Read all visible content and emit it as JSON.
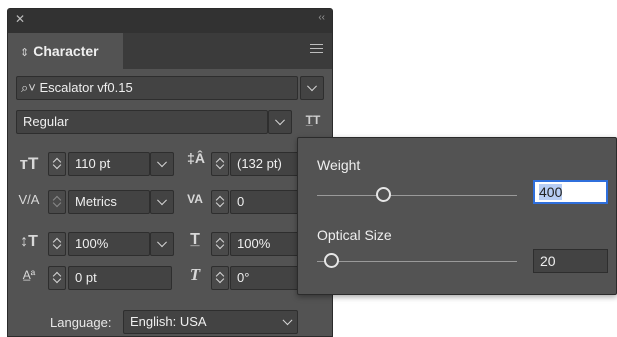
{
  "panel": {
    "tab_label": "Character",
    "font": {
      "search_icon": "search-icon",
      "value": "Escalator vf0.15"
    },
    "style": {
      "value": "Regular"
    },
    "size": {
      "value": "110 pt"
    },
    "leading": {
      "value": "(132 pt)"
    },
    "kerning": {
      "value": "Metrics"
    },
    "tracking": {
      "value": "0"
    },
    "vertical_scale": {
      "value": "100%"
    },
    "horizontal_scale": {
      "value": "100%"
    },
    "baseline_shift": {
      "value": "0 pt"
    },
    "skew": {
      "value": "0°"
    },
    "language": {
      "label": "Language:",
      "value": "English: USA"
    }
  },
  "popover": {
    "weight": {
      "label": "Weight",
      "value": "400",
      "level": 0.33
    },
    "optical_size": {
      "label": "Optical Size",
      "value": "20",
      "level": 0.07
    }
  },
  "colors": {
    "panel_bg": "#535353",
    "field_bg": "#434343",
    "focus_border": "#2f6fdc"
  }
}
